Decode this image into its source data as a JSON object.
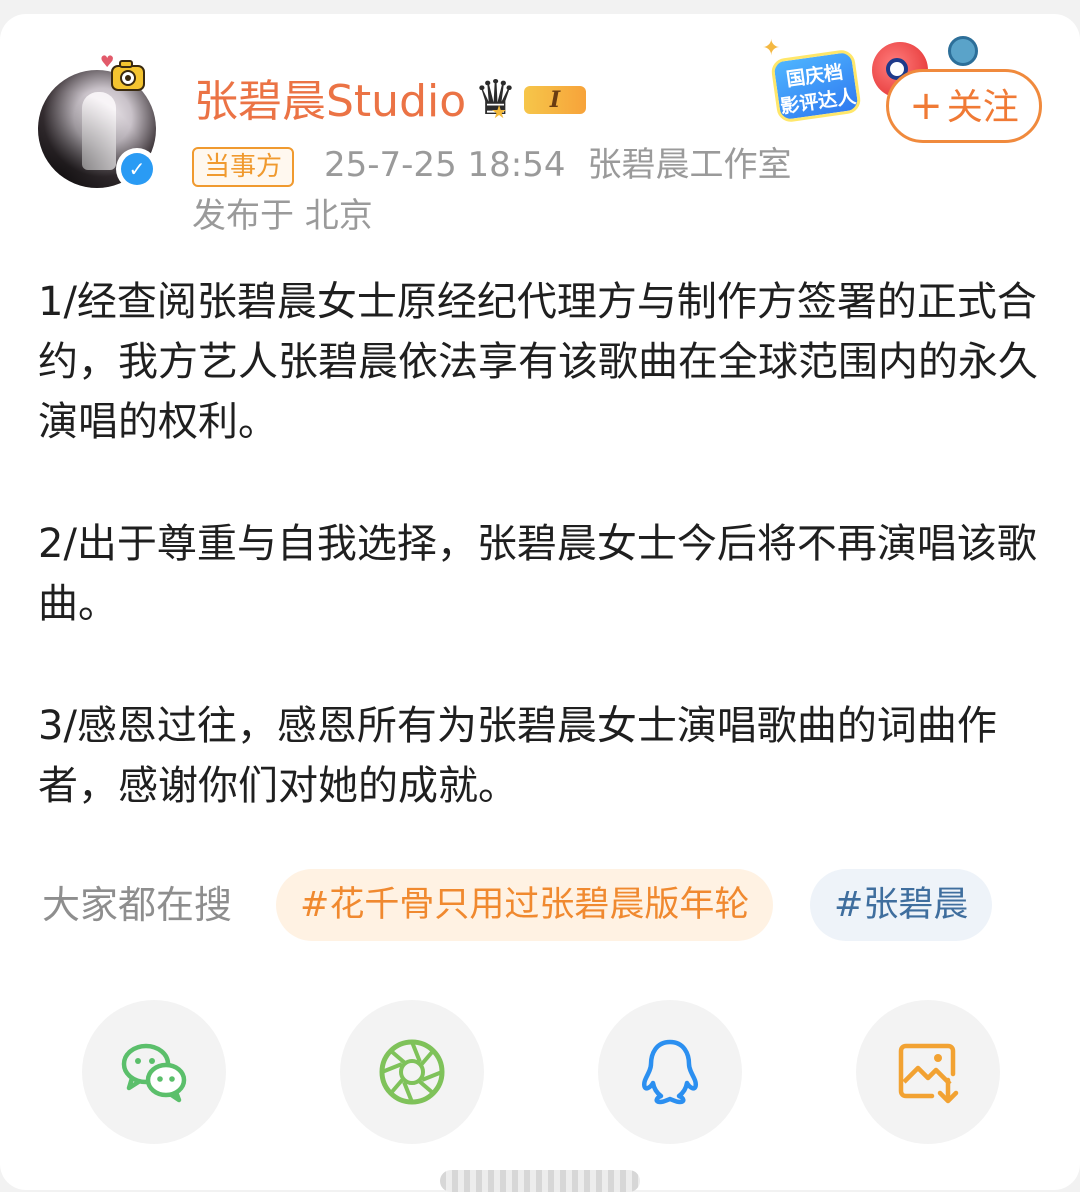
{
  "header": {
    "user_name": "张碧晨Studio",
    "level_label": "I",
    "role_badge": "当事方",
    "timestamp": "25-7-25 18:54",
    "source": "张碧晨工作室",
    "location": "发布于 北京",
    "follow_label": "关注",
    "follow_plus": "+",
    "promo_text": "国庆档 影评达人"
  },
  "post": {
    "paragraphs": [
      "1/经查阅张碧晨女士原经纪代理方与制作方签署的正式合约，我方艺人张碧晨依法享有该歌曲在全球范围内的永久演唱的权利。",
      "2/出于尊重与自我选择，张碧晨女士今后将不再演唱该歌曲。",
      "3/感恩过往，感恩所有为张碧晨女士演唱歌曲的词曲作者，感谢你们对她的成就。"
    ]
  },
  "search": {
    "label": "大家都在搜",
    "tags": [
      "#花千骨只用过张碧晨版年轮",
      "#张碧晨"
    ]
  },
  "share": {
    "icons": [
      "wechat-icon",
      "moments-icon",
      "qq-icon",
      "save-image-icon"
    ]
  },
  "colors": {
    "name": "#eb7345",
    "badge": "#f09a2f",
    "follow": "#f07a35",
    "wechat": "#5bbf6b",
    "moments": "#7fc25a",
    "qq": "#2b8ff0",
    "save": "#f2a232"
  }
}
